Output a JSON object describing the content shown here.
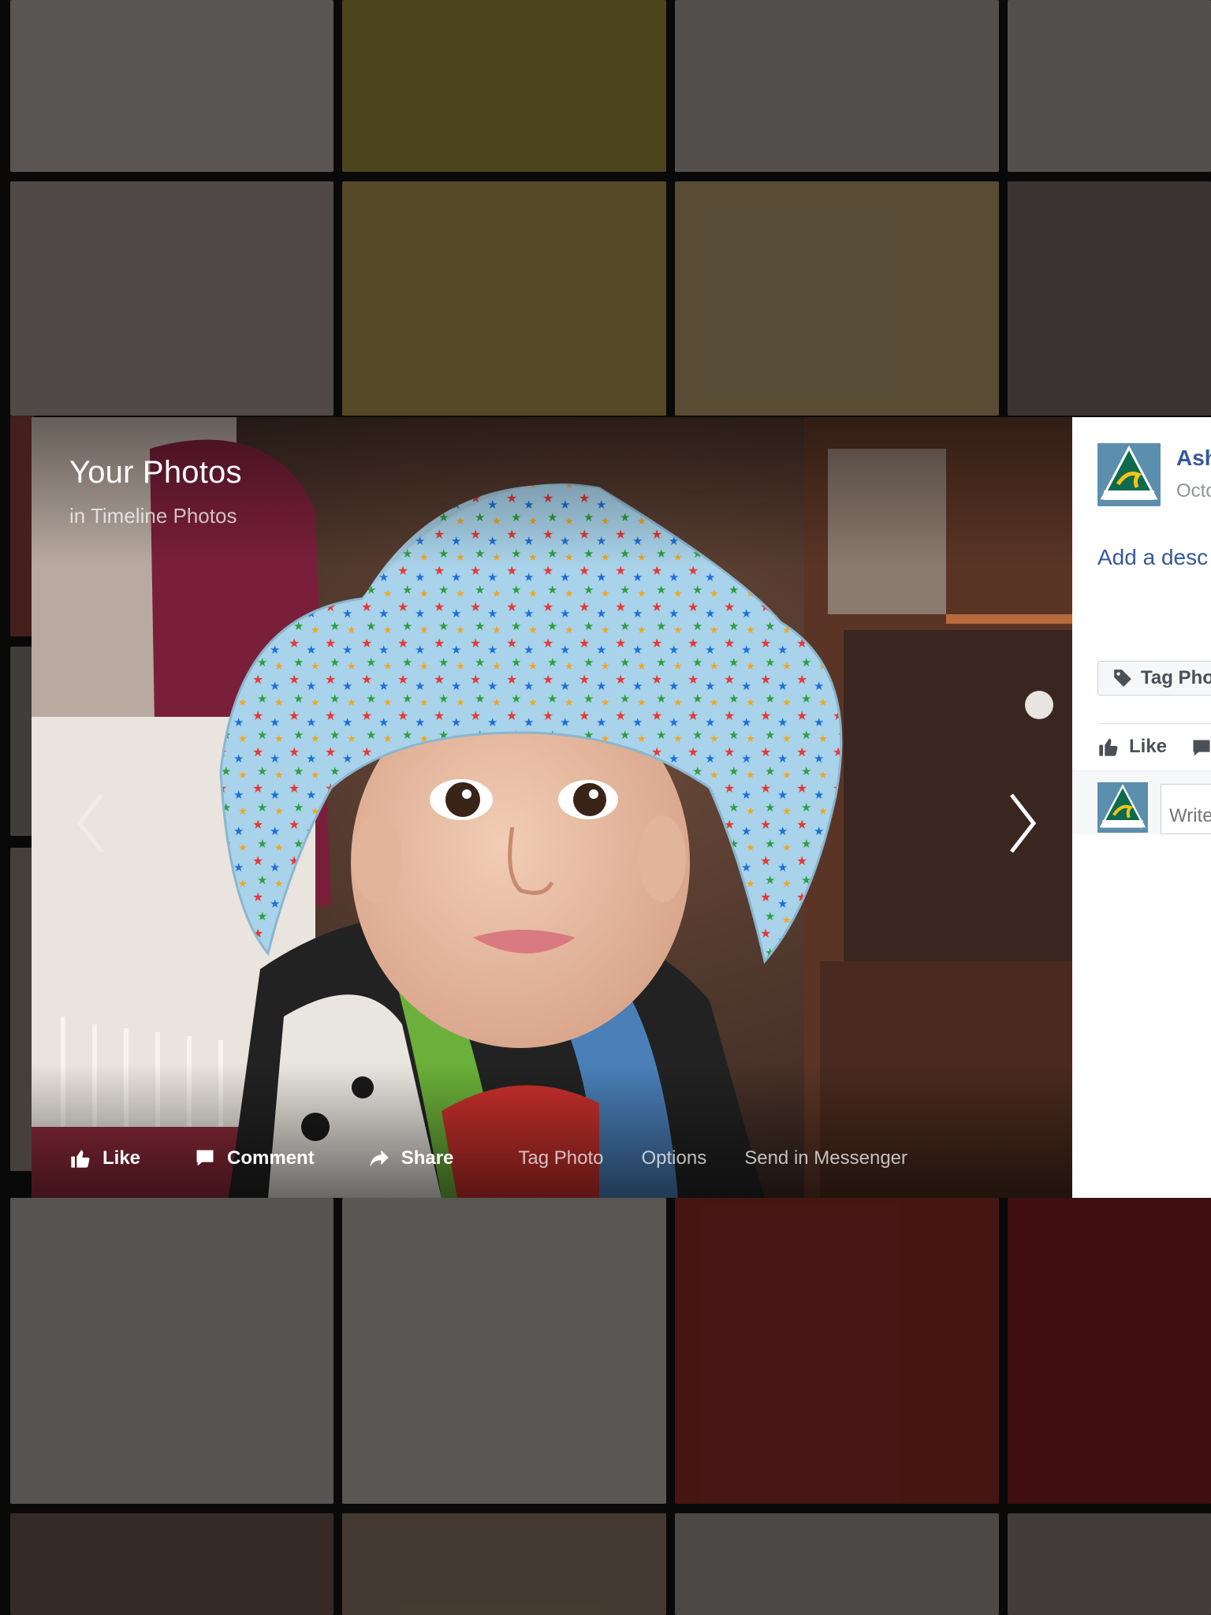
{
  "viewer": {
    "album_title": "Your Photos",
    "album_subtitle": "in Timeline Photos",
    "prev_icon": "chevron-left-icon",
    "next_icon": "chevron-right-icon",
    "actions": {
      "like": "Like",
      "comment": "Comment",
      "share": "Share",
      "tag_photo": "Tag Photo",
      "options": "Options",
      "send_messenger": "Send in Messenger"
    }
  },
  "panel": {
    "author_name": "Ash",
    "post_date": "Octo",
    "add_description": "Add a desc",
    "tag_button": "Tag Pho",
    "like_label": "Like",
    "comment_placeholder": "Write"
  },
  "colors": {
    "link_blue": "#365899",
    "overlay": "#1a1a1a",
    "panel_bg": "#ffffff"
  }
}
